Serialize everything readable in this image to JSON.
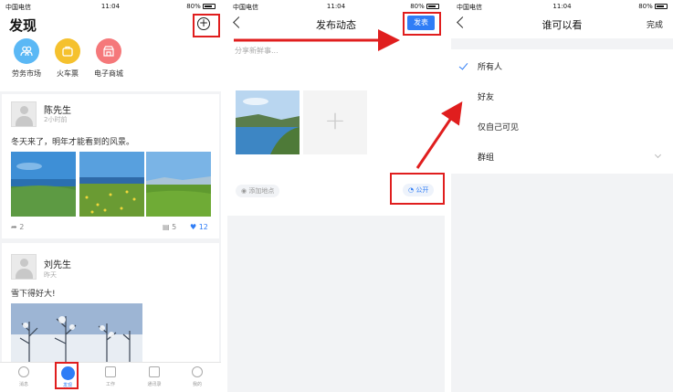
{
  "status_bar": {
    "carrier": "中国电信",
    "time": "11:04",
    "battery": "80%"
  },
  "discover": {
    "title": "发现",
    "quick_actions": [
      {
        "label": "劳务市场",
        "color": "#5bb8f5",
        "icon": "people-icon"
      },
      {
        "label": "火车票",
        "color": "#f5c12e",
        "icon": "bag-icon"
      },
      {
        "label": "电子商城",
        "color": "#f5787a",
        "icon": "shop-icon"
      }
    ],
    "posts": [
      {
        "name": "陈先生",
        "time": "2小时前",
        "text": "冬天来了，明年才能看到的风景。",
        "shares": "2",
        "comments": "5",
        "likes": "12"
      },
      {
        "name": "刘先生",
        "time": "昨天",
        "text": "雪下得好大!"
      }
    ],
    "tabs": [
      {
        "label": "消息",
        "icon": "chat-icon"
      },
      {
        "label": "发现",
        "icon": "compass-icon",
        "active": true
      },
      {
        "label": "工作",
        "icon": "briefcase-icon"
      },
      {
        "label": "通讯录",
        "icon": "contacts-icon"
      },
      {
        "label": "我的",
        "icon": "user-icon"
      }
    ]
  },
  "compose": {
    "title": "发布动态",
    "publish_label": "发表",
    "placeholder": "分享新鲜事...",
    "add_location": "添加地点",
    "visibility": "公开"
  },
  "visibility_page": {
    "title": "谁可以看",
    "done_label": "完成",
    "options": [
      "所有人",
      "好友",
      "仅自己可见",
      "群组"
    ],
    "selected": "所有人"
  },
  "colors": {
    "accent": "#2f7df6",
    "annotation": "#e01e1e"
  }
}
